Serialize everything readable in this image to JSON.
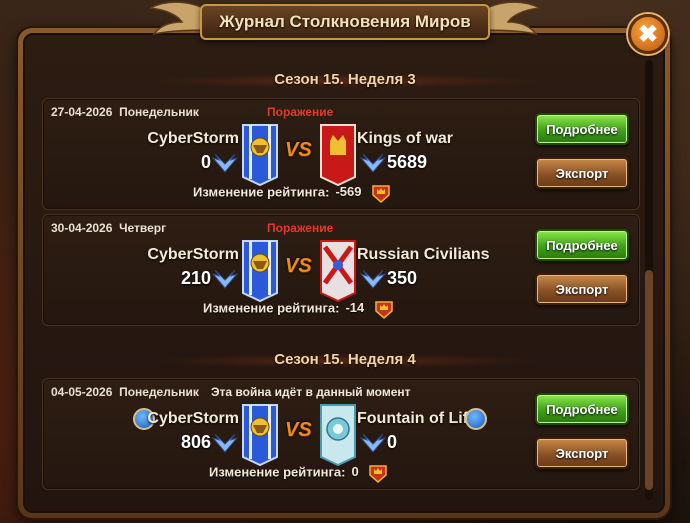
{
  "title": "Журнал Столкновения Миров",
  "close_label": "✖",
  "sections": [
    {
      "season": "Сезон 15. Неделя 3",
      "cards": [
        {
          "date": "27-04-2026",
          "weekday": "Понедельник",
          "status": "Поражение",
          "left_name": "CyberStorm",
          "left_score": "0",
          "right_name": "Kings of war",
          "right_score": "5689",
          "vs": "VS",
          "rating_label": "Изменение рейтинга:",
          "rating_value": "-569",
          "details_label": "Подробнее",
          "export_label": "Экспорт"
        },
        {
          "date": "30-04-2026",
          "weekday": "Четверг",
          "status": "Поражение",
          "left_name": "CyberStorm",
          "left_score": "210",
          "right_name": "Russian Civilians",
          "right_score": "350",
          "vs": "VS",
          "rating_label": "Изменение рейтинга:",
          "rating_value": "-14",
          "details_label": "Подробнее",
          "export_label": "Экспорт"
        }
      ]
    },
    {
      "season": "Сезон 15. Неделя 4",
      "cards": [
        {
          "date": "04-05-2026",
          "weekday": "Понедельник",
          "status": "Эта война идёт в данный момент",
          "left_name": "CyberStorm",
          "left_score": "806",
          "right_name": "Fountain of Life",
          "right_score": "0",
          "vs": "VS",
          "rating_label": "Изменение рейтинга:",
          "rating_value": "0",
          "details_label": "Подробнее",
          "export_label": "Экспорт"
        }
      ]
    }
  ],
  "colors": {
    "defeat": "#e23a2a",
    "vs": "#f08a1a",
    "details_button": "#3fa01a",
    "export_button": "#8a5226"
  },
  "icons": {
    "wings": "wings-rank-icon",
    "crown": "crown-shield-icon",
    "guild_badge": "guild-member-icon"
  }
}
